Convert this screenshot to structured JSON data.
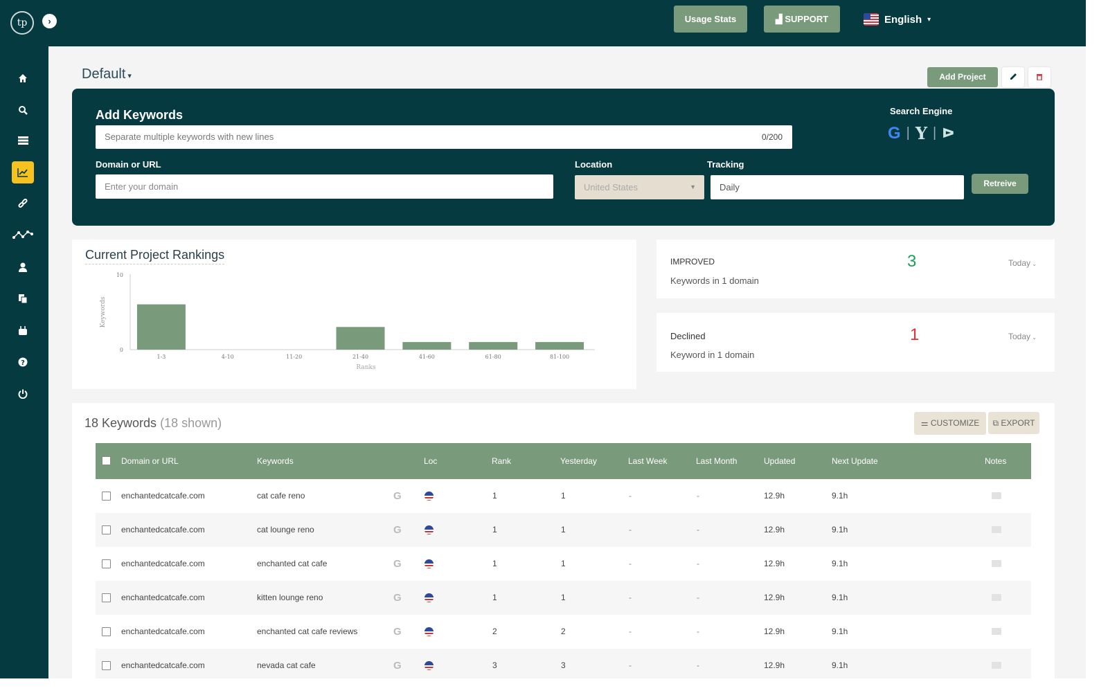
{
  "topbar": {
    "logo_text": "tp",
    "usage_stats": "Usage Stats",
    "support": "SUPPORT",
    "language": "English"
  },
  "sidebar": {
    "items": [
      {
        "name": "home-icon",
        "glyph": "⌂"
      },
      {
        "name": "search-icon",
        "glyph": "🔍"
      },
      {
        "name": "list-icon",
        "glyph": "☰"
      },
      {
        "name": "chart-icon",
        "glyph": "📈",
        "active": true
      },
      {
        "name": "link-icon",
        "glyph": "🔗"
      },
      {
        "name": "network-icon",
        "glyph": "⋰"
      },
      {
        "name": "user-icon",
        "glyph": "👤"
      },
      {
        "name": "copy-icon",
        "glyph": "⧉"
      },
      {
        "name": "youtube-icon",
        "glyph": "▣"
      },
      {
        "name": "help-icon",
        "glyph": "?"
      },
      {
        "name": "power-icon",
        "glyph": "⏻"
      }
    ]
  },
  "header": {
    "project": "Default",
    "add_project": "Add Project"
  },
  "add_keywords": {
    "title": "Add Keywords",
    "keywords_placeholder": "Separate multiple keywords with new lines",
    "keywords_count": "0/200",
    "domain_label": "Domain or URL",
    "domain_placeholder": "Enter your domain",
    "location_label": "Location",
    "location_value": "United States",
    "tracking_label": "Tracking",
    "tracking_value": "Daily",
    "search_engine_label": "Search Engine",
    "retrieve": "Retreive"
  },
  "rankings": {
    "title": "Current Project Rankings"
  },
  "chart_data": {
    "type": "bar",
    "title": "Current Project Rankings",
    "xlabel": "Ranks",
    "ylabel": "Keywords",
    "categories": [
      "1-3",
      "4-10",
      "11-20",
      "21-40",
      "41-60",
      "61-80",
      "81-100"
    ],
    "values": [
      6,
      0,
      0,
      3,
      1,
      1,
      1
    ],
    "ylim": [
      0,
      10
    ],
    "yticks": [
      "10",
      "0"
    ],
    "color": "#7a9a7c"
  },
  "stats": {
    "improved": {
      "label": "IMPROVED",
      "value": "3",
      "sub": "Keywords in 1 domain",
      "period": "Today",
      "color": "#1aa05a"
    },
    "declined": {
      "label": "Declined",
      "value": "1",
      "sub": "Keyword in 1 domain",
      "period": "Today",
      "color": "#e0313a"
    }
  },
  "table": {
    "count": "18 Keywords",
    "shown": "(18 shown)",
    "customize": "CUSTOMIZE",
    "export": "EXPORT",
    "headers": [
      "Domain or URL",
      "Keywords",
      "Loc",
      "Rank",
      "Yesterday",
      "Last Week",
      "Last Month",
      "Updated",
      "Next Update",
      "Notes"
    ],
    "rows": [
      {
        "domain": "enchantedcatcafe.com",
        "keyword": "cat cafe reno",
        "rank": "1",
        "yesterday": "1",
        "last_week": "-",
        "last_month": "-",
        "updated": "12.9h",
        "next_update": "9.1h"
      },
      {
        "domain": "enchantedcatcafe.com",
        "keyword": "cat lounge reno",
        "rank": "1",
        "yesterday": "1",
        "last_week": "-",
        "last_month": "-",
        "updated": "12.9h",
        "next_update": "9.1h"
      },
      {
        "domain": "enchantedcatcafe.com",
        "keyword": "enchanted cat cafe",
        "rank": "1",
        "yesterday": "1",
        "last_week": "-",
        "last_month": "-",
        "updated": "12.9h",
        "next_update": "9.1h"
      },
      {
        "domain": "enchantedcatcafe.com",
        "keyword": "kitten lounge reno",
        "rank": "1",
        "yesterday": "1",
        "last_week": "-",
        "last_month": "-",
        "updated": "12.9h",
        "next_update": "9.1h"
      },
      {
        "domain": "enchantedcatcafe.com",
        "keyword": "enchanted cat cafe reviews",
        "rank": "2",
        "yesterday": "2",
        "last_week": "-",
        "last_month": "-",
        "updated": "12.9h",
        "next_update": "9.1h"
      },
      {
        "domain": "enchantedcatcafe.com",
        "keyword": "nevada cat cafe",
        "rank": "3",
        "yesterday": "3",
        "last_week": "-",
        "last_month": "-",
        "updated": "12.9h",
        "next_update": "9.1h"
      }
    ]
  }
}
